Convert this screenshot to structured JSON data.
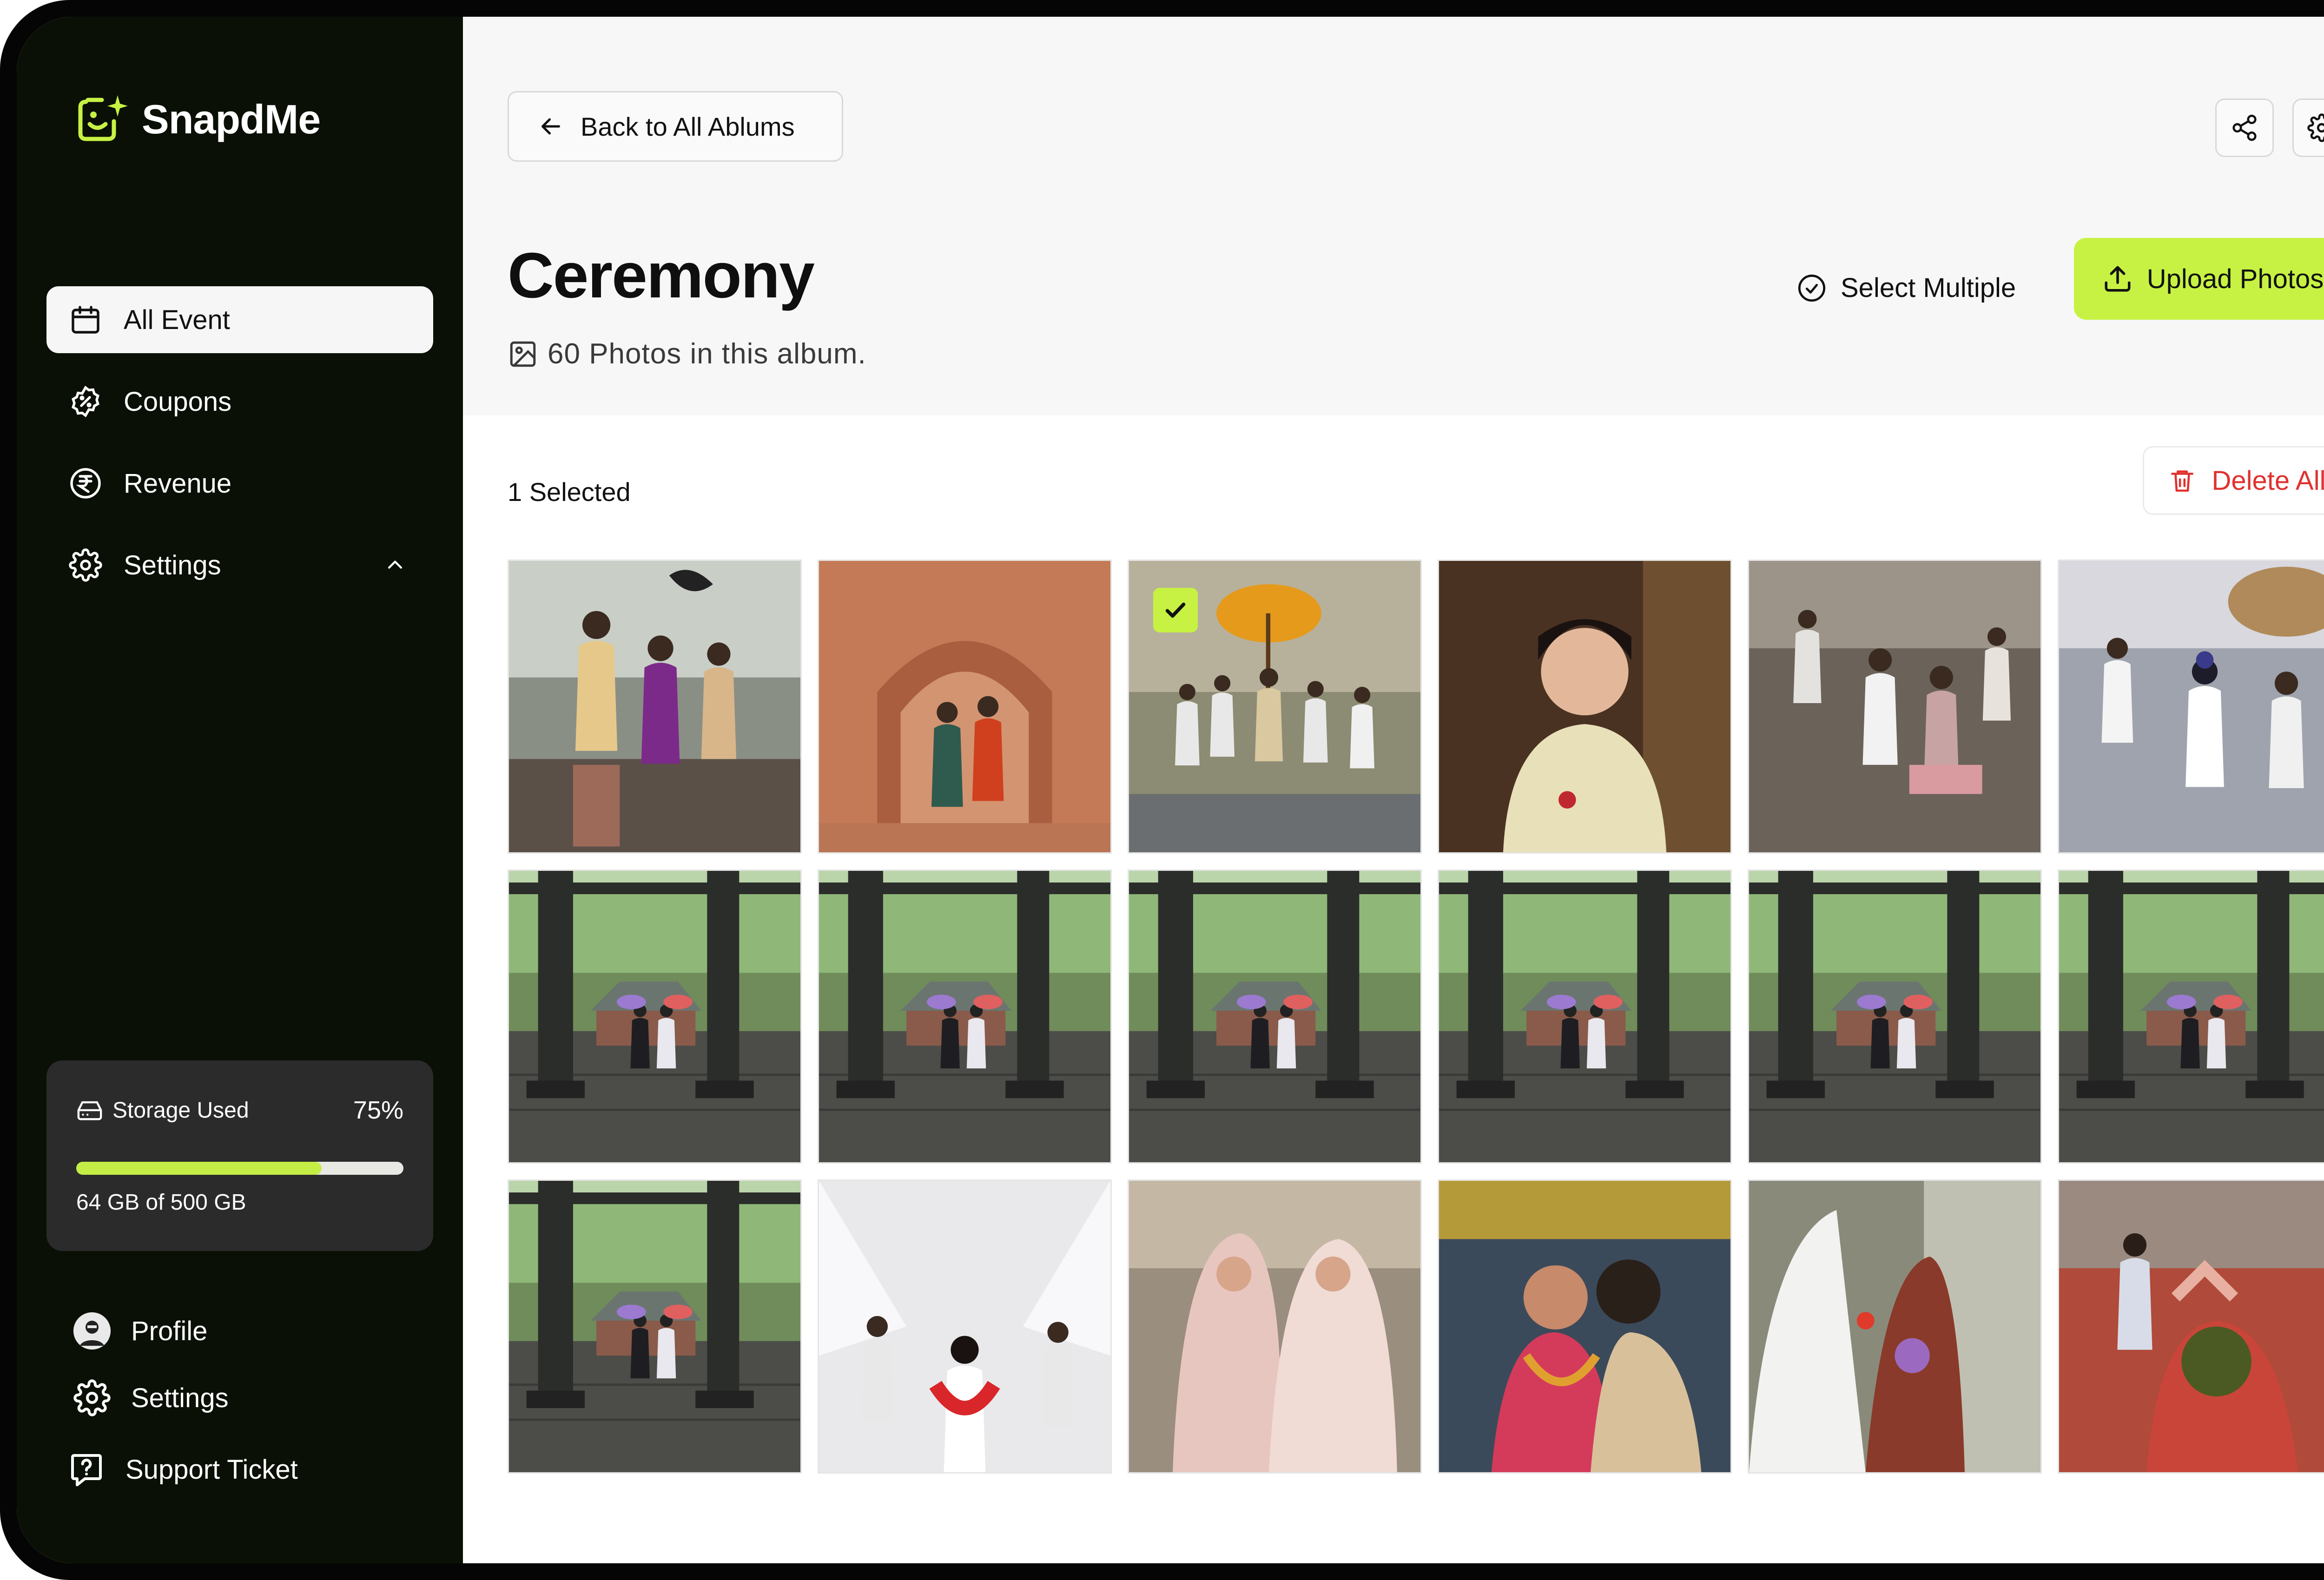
{
  "app": {
    "name": "SnapdMe"
  },
  "sidebar": {
    "nav": [
      {
        "label": "All Event",
        "icon": "calendar-icon",
        "active": true
      },
      {
        "label": "Coupons",
        "icon": "coupon-icon",
        "active": false
      },
      {
        "label": "Revenue",
        "icon": "rupee-icon",
        "active": false
      },
      {
        "label": "Settings",
        "icon": "gear-icon",
        "active": false,
        "expanded": true
      }
    ],
    "storage": {
      "label": "Storage Used",
      "percent_label": "75%",
      "percent": 0.75,
      "capacity_text": "64 GB of 500 GB"
    },
    "bottom": [
      {
        "label": "Profile",
        "icon": "avatar"
      },
      {
        "label": "Settings",
        "icon": "gear-icon"
      },
      {
        "label": "Support Ticket",
        "icon": "help-icon"
      }
    ]
  },
  "header": {
    "back_label": "Back to All Ablums",
    "album_title": "Ceremony",
    "photo_count_text": "60 Photos in this album.",
    "select_multiple_label": "Select Multiple",
    "upload_label": "Upload Photos"
  },
  "toolbar": {
    "selected_text": "1 Selected",
    "delete_label": "Delete All"
  },
  "colors": {
    "accent": "#c7f243",
    "danger": "#e0312f",
    "sidebar_bg": "#0a1005"
  },
  "photos": [
    {
      "scene": "wedding-couple-fan",
      "selected": false
    },
    {
      "scene": "couple-archway",
      "selected": false
    },
    {
      "scene": "procession-umbrella",
      "selected": true
    },
    {
      "scene": "bride-portrait",
      "selected": false
    },
    {
      "scene": "temple-prayer",
      "selected": false
    },
    {
      "scene": "festival-crowd",
      "selected": false
    },
    {
      "scene": "torii-couple",
      "selected": false
    },
    {
      "scene": "torii-couple",
      "selected": false
    },
    {
      "scene": "torii-couple",
      "selected": false
    },
    {
      "scene": "torii-couple",
      "selected": false
    },
    {
      "scene": "torii-couple",
      "selected": false
    },
    {
      "scene": "torii-couple",
      "selected": false
    },
    {
      "scene": "torii-couple",
      "selected": false
    },
    {
      "scene": "island-ceremony",
      "selected": false
    },
    {
      "scene": "veiled-women",
      "selected": false
    },
    {
      "scene": "garland-exchange",
      "selected": false
    },
    {
      "scene": "flower-ritual",
      "selected": false
    },
    {
      "scene": "haldi-celebration",
      "selected": false
    }
  ]
}
